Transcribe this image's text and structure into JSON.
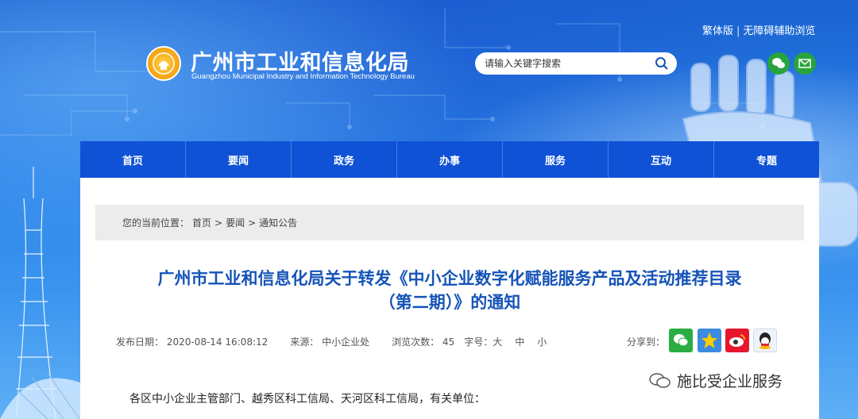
{
  "header": {
    "lang_traditional": "繁体版",
    "separator": "|",
    "accessibility": "无障碍辅助浏览",
    "site_title": "广州市工业和信息化局",
    "site_subtitle": "Guangzhou Municipal Industry and Information Technology Bureau",
    "search_placeholder": "请输入关键字搜索"
  },
  "nav": {
    "items": [
      "首页",
      "要闻",
      "政务",
      "办事",
      "服务",
      "互动",
      "专题"
    ]
  },
  "breadcrumb": {
    "label": "您的当前位置：",
    "crumbs": [
      "首页",
      ">",
      "要闻",
      ">",
      "通知公告"
    ]
  },
  "article": {
    "title_line1": "广州市工业和信息化局关于转发《中小企业数字化赋能服务产品及活动推荐目录",
    "title_line2": "（第二期）》的通知",
    "publish_date": "发布日期：  2020-08-14 16:08:12",
    "source": "来源：  中小企业处",
    "views": "浏览次数：  45",
    "font_size_label": "字号：",
    "font_size_large": "大",
    "font_size_medium": "中",
    "font_size_small": "小",
    "share_label": "分享到：",
    "body_first_line": "各区中小企业主管部门、越秀区科工信局、天河区科工信局，有关单位："
  },
  "watermark": {
    "text": "施比受企业服务"
  },
  "colors": {
    "nav_bg": "#0f52d6",
    "title_blue": "#1554b8",
    "wechat_green": "#27a53c"
  }
}
